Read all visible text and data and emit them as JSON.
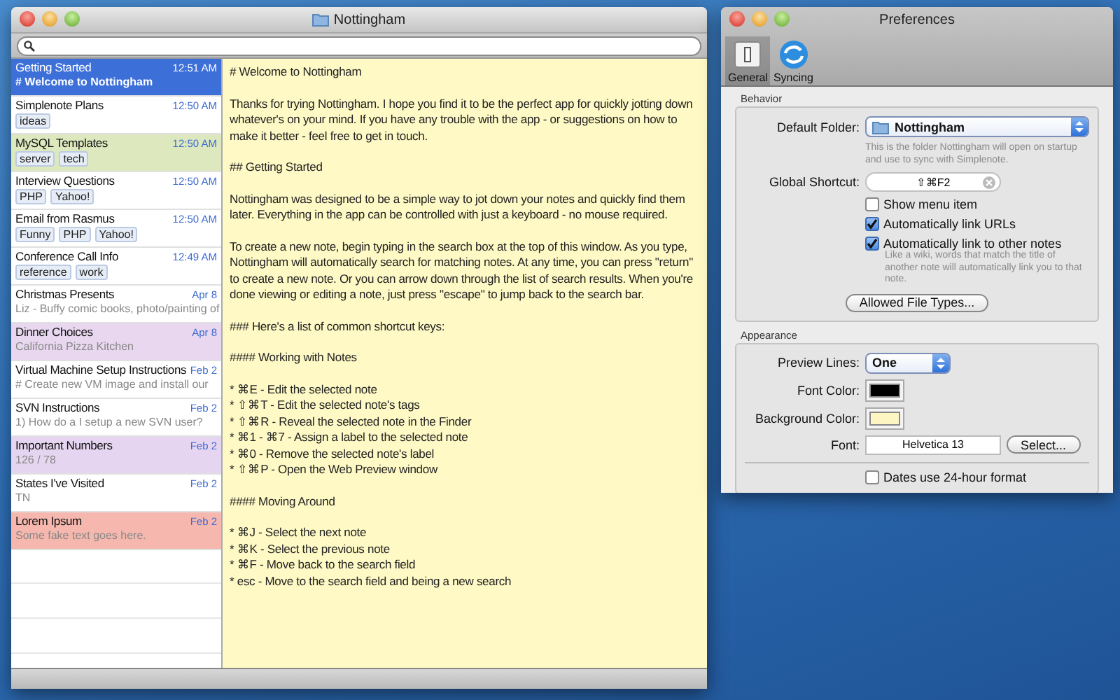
{
  "main_window": {
    "title": "Nottingham",
    "notes": [
      {
        "title": "Getting Started",
        "time": "12:51 AM",
        "preview": "# Welcome to Nottingham",
        "color": "#3d6fd9",
        "selected": true
      },
      {
        "title": "Simplenote Plans",
        "time": "12:50 AM",
        "tags": [
          "ideas"
        ],
        "color": "#ffffff",
        "selected": false
      },
      {
        "title": "MySQL Templates",
        "time": "12:50 AM",
        "tags": [
          "server",
          "tech"
        ],
        "color": "#dde8bf",
        "selected": false
      },
      {
        "title": "Interview Questions",
        "time": "12:50 AM",
        "tags": [
          "PHP",
          "Yahoo!"
        ],
        "color": "#ffffff",
        "selected": false
      },
      {
        "title": "Email from Rasmus",
        "time": "12:50 AM",
        "tags": [
          "Funny",
          "PHP",
          "Yahoo!"
        ],
        "color": "#ffffff",
        "selected": false
      },
      {
        "title": "Conference Call Info",
        "time": "12:49 AM",
        "tags": [
          "reference",
          "work"
        ],
        "color": "#ffffff",
        "selected": false
      },
      {
        "title": "Christmas Presents",
        "time": "Apr 8",
        "preview": "Liz - Buffy comic books, photo/painting of",
        "color": "#ffffff",
        "selected": false
      },
      {
        "title": "Dinner Choices",
        "time": "Apr 8",
        "preview": "California Pizza Kitchen",
        "color": "#e8d7ef",
        "selected": false
      },
      {
        "title": "Virtual Machine Setup Instructions",
        "time": "Feb 2",
        "preview": "# Create new VM image and install our",
        "color": "#ffffff",
        "selected": false
      },
      {
        "title": "SVN Instructions",
        "time": "Feb 2",
        "preview": "1) How do a I setup a new SVN user?",
        "color": "#ffffff",
        "selected": false
      },
      {
        "title": "Important Numbers",
        "time": "Feb 2",
        "preview": "126 / 78",
        "color": "#e6d5f0",
        "selected": false
      },
      {
        "title": "States I've Visited",
        "time": "Feb 2",
        "preview": "TN",
        "color": "#ffffff",
        "selected": false
      },
      {
        "title": "Lorem Ipsum",
        "time": "Feb 2",
        "preview": "Some fake text goes here.",
        "color": "#f6b8ae",
        "selected": false
      }
    ],
    "note_body": [
      {
        "kind": "text",
        "text": "# Welcome to Nottingham"
      },
      {
        "kind": "text",
        "text": "Thanks for trying Nottingham. I hope you find it to be the perfect app for quickly jotting down whatever's on your mind. If you have any trouble with the app - or suggestions on how to make it better - feel free to get in touch."
      },
      {
        "kind": "text",
        "text": "## Getting Started"
      },
      {
        "kind": "text",
        "text": "Nottingham was designed to be a simple way to jot down your notes and quickly find them later. Everything in the app can be controlled with just a keyboard - no mouse required."
      },
      {
        "kind": "text",
        "text": "To create a new note, begin typing in the search box at the top of this window. As you type, Nottingham will automatically search for matching notes. At any time, you can press \"return\" to create a new note. Or you can arrow down through the list of search results. When you're done viewing or editing a note, just press \"escape\" to jump back to the search bar."
      },
      {
        "kind": "text",
        "text": "### Here's a list of common shortcut keys:"
      },
      {
        "kind": "text",
        "text": "#### Working with Notes"
      },
      {
        "kind": "list",
        "items": [
          "* ⌘E - Edit the selected note",
          "* ⇧⌘T - Edit the selected note's tags",
          "* ⇧⌘R - Reveal the selected note in the Finder",
          "* ⌘1 - ⌘7 - Assign a label to the selected note",
          "* ⌘0 - Remove the selected note's label",
          "* ⇧⌘P - Open the Web Preview window"
        ]
      },
      {
        "kind": "text",
        "text": "#### Moving Around"
      },
      {
        "kind": "list",
        "items": [
          "* ⌘J - Select the next note",
          "* ⌘K - Select the previous note",
          "* ⌘F - Move back to the search field",
          "* esc - Move to the search field and being a new search"
        ]
      }
    ]
  },
  "preferences": {
    "title": "Preferences",
    "tabs": [
      {
        "label": "General",
        "selected": true
      },
      {
        "label": "Syncing",
        "selected": false
      }
    ],
    "behavior": {
      "title": "Behavior",
      "default_folder": {
        "label": "Default Folder:",
        "value": "Nottingham",
        "hint": "This is the folder Nottingham will open on startup and use to sync with Simplenote."
      },
      "global_shortcut": {
        "label": "Global Shortcut:",
        "value": "⇧⌘F2"
      },
      "checkboxes": [
        {
          "label": "Show menu item",
          "checked": false
        },
        {
          "label": "Automatically link URLs",
          "checked": true
        },
        {
          "label": "Automatically link to other notes",
          "checked": true,
          "hint": "Like a wiki, words that match the title of another note will automatically link you to that note."
        }
      ],
      "button": "Allowed File Types..."
    },
    "appearance": {
      "title": "Appearance",
      "preview_lines": {
        "label": "Preview Lines:",
        "value": "One"
      },
      "font_color": {
        "label": "Font Color:",
        "color": "#000000"
      },
      "background_color": {
        "label": "Background Color:",
        "color": "#fdf6c3"
      },
      "font": {
        "label": "Font:",
        "value": "Helvetica 13",
        "button": "Select..."
      },
      "checkbox": {
        "label": "Dates use 24-hour format",
        "checked": false
      }
    }
  }
}
